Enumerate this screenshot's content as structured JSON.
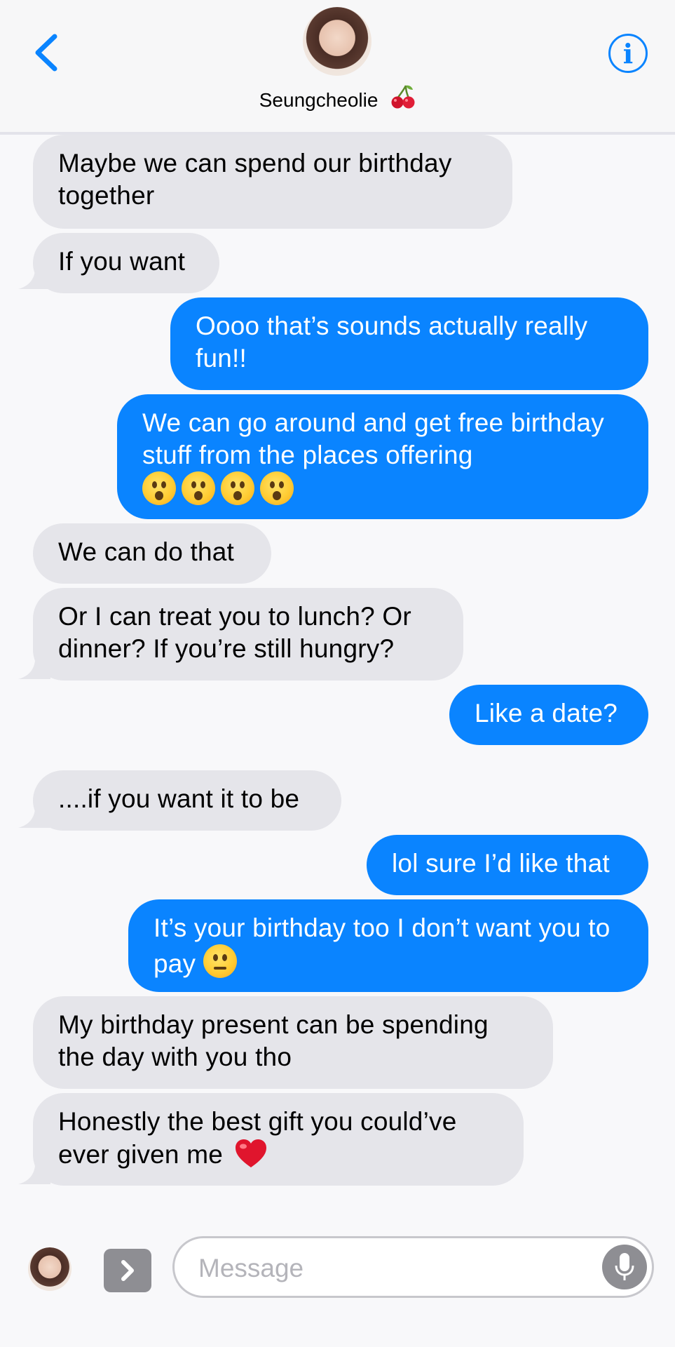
{
  "header": {
    "contact_name": "Seungcheolie",
    "contact_emoji": "cherry",
    "back_icon": "chevron-left-icon",
    "info_icon": "info-icon",
    "info_glyph": "i"
  },
  "colors": {
    "outgoing_bubble": "#0a84ff",
    "incoming_bubble": "#e5e5ea",
    "accent": "#0a84ff"
  },
  "messages": [
    {
      "direction": "incoming",
      "text": "Maybe we can spend our birthday together"
    },
    {
      "direction": "incoming",
      "text": "If you want"
    },
    {
      "direction": "outgoing",
      "text": "Oooo that’s sounds actually really fun!!"
    },
    {
      "direction": "outgoing",
      "text": "We can go around and get free birthday stuff from the places offering",
      "emoji": "hushed-face x4"
    },
    {
      "direction": "incoming",
      "text": "We can do that"
    },
    {
      "direction": "incoming",
      "text": "Or I can treat you to lunch? Or dinner? If you’re still hungry?"
    },
    {
      "direction": "outgoing",
      "text": "Like a date?"
    },
    {
      "direction": "incoming",
      "text": "....if you want it to be"
    },
    {
      "direction": "outgoing",
      "text": "lol sure I’d like that"
    },
    {
      "direction": "outgoing",
      "text": "It’s your birthday too I don’t want you to pay",
      "emoji": "pensive-face"
    },
    {
      "direction": "incoming",
      "text": "My birthday present can be spending the day with you tho"
    },
    {
      "direction": "incoming",
      "text": "Honestly the best gift you could’ve ever given me",
      "emoji": "red-heart"
    }
  ],
  "composer": {
    "placeholder": "Message",
    "value": "",
    "apps_icon": "chevron-right-icon",
    "mic_icon": "microphone-icon"
  }
}
